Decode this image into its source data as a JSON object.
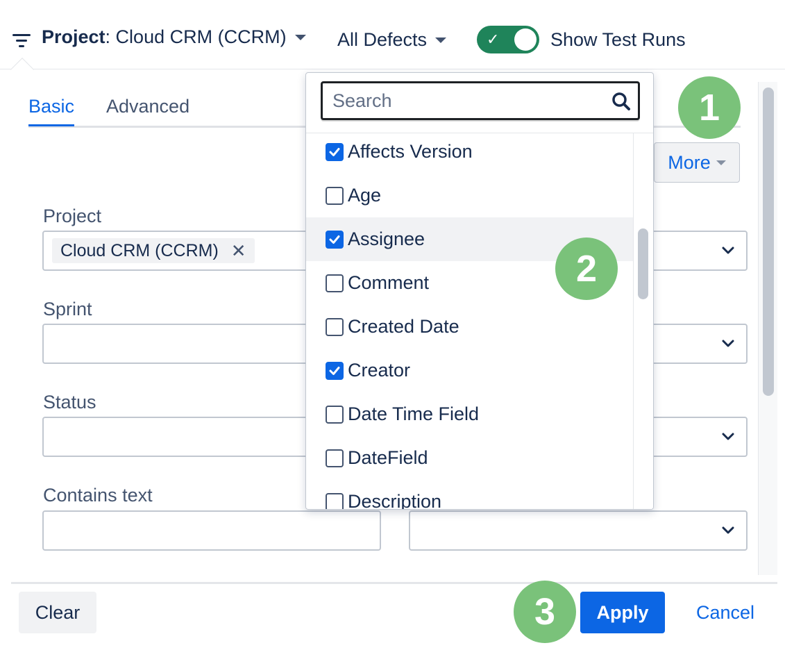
{
  "header": {
    "project_label": "Project",
    "project_value": ": Cloud CRM (CCRM)",
    "defects_label": "All Defects",
    "toggle_label": "Show Test Runs",
    "toggle_on": true
  },
  "tabs": [
    {
      "label": "Basic",
      "active": true
    },
    {
      "label": "Advanced",
      "active": false
    }
  ],
  "more_label": "More",
  "fields": {
    "project": {
      "label": "Project",
      "chip": "Cloud CRM (CCRM)"
    },
    "sprint": {
      "label": "Sprint"
    },
    "status": {
      "label": "Status"
    },
    "contains_text": {
      "label": "Contains text"
    }
  },
  "dropdown": {
    "search_placeholder": "Search",
    "items": [
      {
        "label": "Affects Version",
        "checked": true
      },
      {
        "label": "Age",
        "checked": false
      },
      {
        "label": "Assignee",
        "checked": true,
        "hover": true
      },
      {
        "label": "Comment",
        "checked": false
      },
      {
        "label": "Created Date",
        "checked": false
      },
      {
        "label": "Creator",
        "checked": true
      },
      {
        "label": "Date Time Field",
        "checked": false
      },
      {
        "label": "DateField",
        "checked": false
      },
      {
        "label": "Description",
        "checked": false
      }
    ]
  },
  "footer": {
    "clear_label": "Clear",
    "apply_label": "Apply",
    "cancel_label": "Cancel"
  },
  "badges": [
    "1",
    "2",
    "3"
  ],
  "colors": {
    "accent": "#0c66e4",
    "toggle_on": "#1f845a",
    "badge": "#7ac27a"
  }
}
